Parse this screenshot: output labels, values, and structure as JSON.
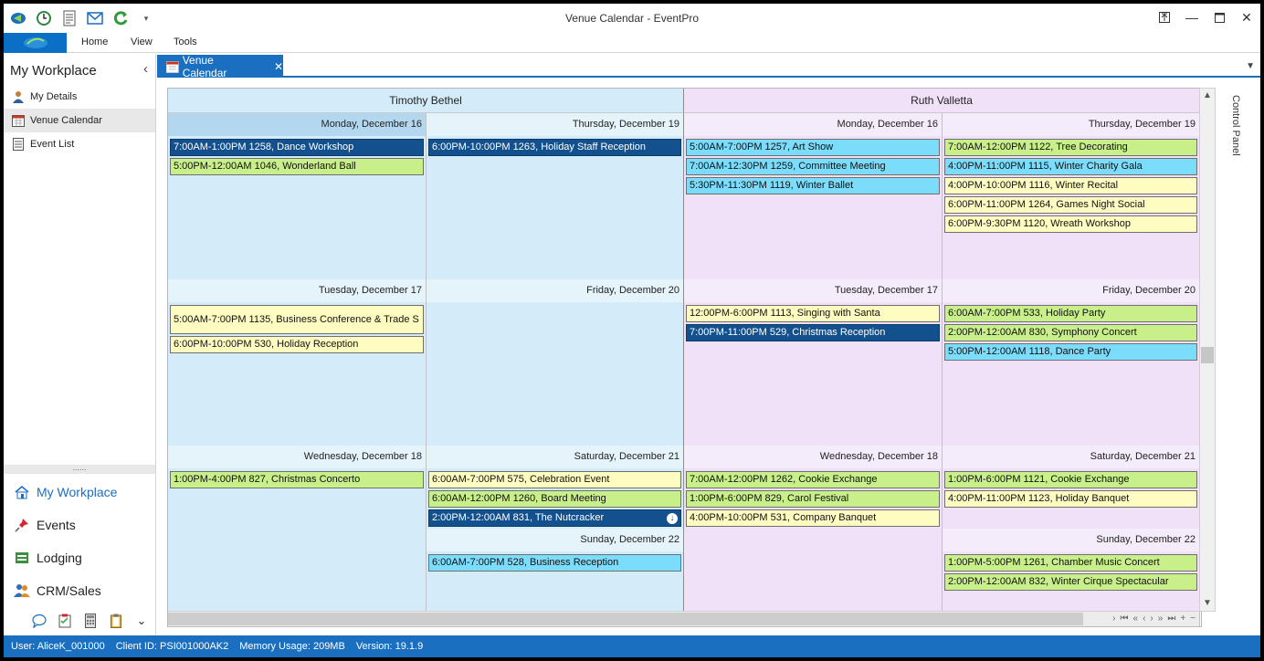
{
  "window": {
    "title": "Venue Calendar - EventPro"
  },
  "ribbon": {
    "tabs": [
      "Home",
      "View",
      "Tools"
    ]
  },
  "sidebar": {
    "title": "My Workplace",
    "items": [
      {
        "label": "My Details",
        "icon": "user-icon"
      },
      {
        "label": "Venue Calendar",
        "icon": "calendar-icon"
      },
      {
        "label": "Event List",
        "icon": "list-icon"
      }
    ],
    "nav": [
      {
        "label": "My Workplace",
        "icon": "home-icon"
      },
      {
        "label": "Events",
        "icon": "pin-icon"
      },
      {
        "label": "Lodging",
        "icon": "bed-icon"
      },
      {
        "label": "CRM/Sales",
        "icon": "people-icon"
      }
    ],
    "splitter_grip": "......"
  },
  "doc_tab": {
    "label": "Venue Calendar"
  },
  "control_panel": {
    "label": "Control Panel"
  },
  "calendar": {
    "resources": [
      "Timothy Bethel",
      "Ruth Valletta"
    ],
    "days": {
      "mon": "Monday, December 16",
      "thu": "Thursday, December 19",
      "tue": "Tuesday, December 17",
      "fri": "Friday, December 20",
      "wed": "Wednesday, December 18",
      "sat": "Saturday, December 21",
      "sun": "Sunday, December 22"
    },
    "events": {
      "tb_mon": [
        "7:00AM-1:00PM 1258, Dance Workshop",
        "5:00PM-12:00AM 1046, Wonderland Ball"
      ],
      "tb_thu": [
        "6:00PM-10:00PM 1263, Holiday Staff Reception"
      ],
      "rv_mon": [
        "5:00AM-7:00PM 1257, Art Show",
        "7:00AM-12:30PM 1259, Committee Meeting",
        "5:30PM-11:30PM 1119, Winter Ballet"
      ],
      "rv_thu": [
        "7:00AM-12:00PM 1122, Tree Decorating",
        "4:00PM-11:00PM 1115, Winter Charity Gala",
        "4:00PM-10:00PM 1116, Winter Recital",
        "6:00PM-11:00PM 1264, Games Night Social",
        "6:00PM-9:30PM 1120, Wreath Workshop"
      ],
      "tb_tue": [
        "5:00AM-7:00PM 1135, Business Conference & Trade S",
        "6:00PM-10:00PM 530, Holiday Reception"
      ],
      "tb_fri": [],
      "rv_tue": [
        "12:00PM-6:00PM 1113, Singing with Santa",
        "7:00PM-11:00PM 529, Christmas Reception"
      ],
      "rv_fri": [
        "6:00AM-7:00PM 533, Holiday Party",
        "2:00PM-12:00AM 830, Symphony Concert",
        "5:00PM-12:00AM 1118, Dance Party"
      ],
      "tb_wed": [
        "1:00PM-4:00PM 827, Christmas Concerto"
      ],
      "tb_sat": [
        "6:00AM-7:00PM 575, Celebration Event",
        "6:00AM-12:00PM 1260, Board Meeting",
        "2:00PM-12:00AM 831, The Nutcracker"
      ],
      "tb_sun": [
        "6:00AM-7:00PM 528, Business Reception"
      ],
      "rv_wed": [
        "7:00AM-12:00PM 1262, Cookie Exchange",
        "1:00PM-6:00PM 829, Carol Festival",
        "4:00PM-10:00PM 531, Company Banquet"
      ],
      "rv_sat": [
        "1:00PM-6:00PM 1121, Cookie Exchange",
        "4:00PM-11:00PM 1123, Holiday Banquet"
      ],
      "rv_sun": [
        "1:00PM-5:00PM 1261, Chamber Music Concert",
        "2:00PM-12:00AM 832, Winter Cirque Spectacular"
      ]
    },
    "colors": {
      "green": "#c8ef8a",
      "yellow": "#fffcc2",
      "blue": "#7bdcfb",
      "navy": "#13508e"
    }
  },
  "statusbar": {
    "user": "User: AliceK_001000",
    "client": "Client ID: PSI001000AK2",
    "memory": "Memory Usage: 209MB",
    "version": "Version: 19.1.9"
  }
}
